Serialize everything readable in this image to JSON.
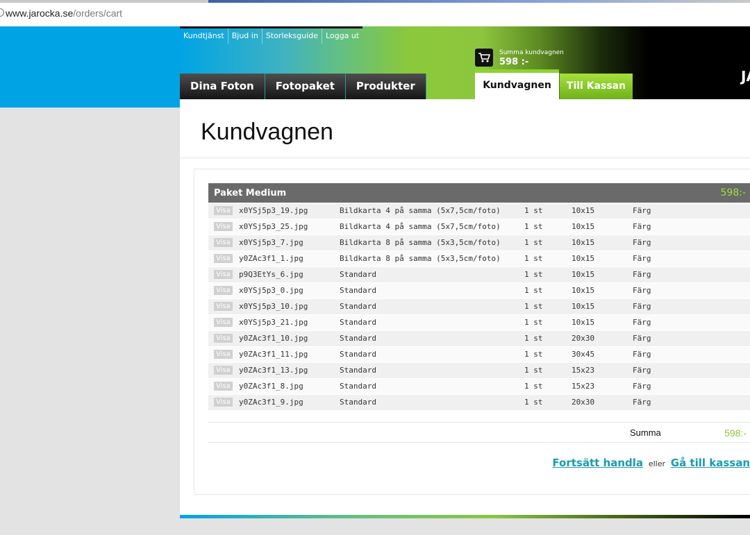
{
  "browser": {
    "url_domain": "www.jarocka.se",
    "url_path": "/orders/cart"
  },
  "topnav": [
    "Kundtjänst",
    "Bjud in",
    "Storleksguide",
    "Logga ut"
  ],
  "cart_summary": {
    "label": "Summa kundvagnen",
    "amount": "598 :-"
  },
  "tabs": [
    "Dina Foton",
    "Fotopaket",
    "Produkter"
  ],
  "active_tab": "Kundvagnen",
  "checkout_tab": "Till Kassan",
  "logo_text": "JA",
  "page_title": "Kundvagnen",
  "package": {
    "name": "Paket Medium",
    "price": "598:-"
  },
  "view_label": "Visa",
  "rows": [
    {
      "file": "x0YSj5p3_19.jpg",
      "product": "Bildkarta 4 på samma (5x7,5cm/foto)",
      "qty": "1 st",
      "size": "10x15",
      "color": "Färg"
    },
    {
      "file": "x0YSj5p3_25.jpg",
      "product": "Bildkarta 4 på samma (5x7,5cm/foto)",
      "qty": "1 st",
      "size": "10x15",
      "color": "Färg"
    },
    {
      "file": "x0YSj5p3_7.jpg",
      "product": "Bildkarta 8 på samma (5x3,5cm/foto)",
      "qty": "1 st",
      "size": "10x15",
      "color": "Färg"
    },
    {
      "file": "y0ZAc3f1_1.jpg",
      "product": "Bildkarta 8 på samma (5x3,5cm/foto)",
      "qty": "1 st",
      "size": "10x15",
      "color": "Färg"
    },
    {
      "file": "p9Q3EtYs_6.jpg",
      "product": "Standard",
      "qty": "1 st",
      "size": "10x15",
      "color": "Färg"
    },
    {
      "file": "x0YSj5p3_0.jpg",
      "product": "Standard",
      "qty": "1 st",
      "size": "10x15",
      "color": "Färg"
    },
    {
      "file": "x0YSj5p3_10.jpg",
      "product": "Standard",
      "qty": "1 st",
      "size": "10x15",
      "color": "Färg"
    },
    {
      "file": "x0YSj5p3_21.jpg",
      "product": "Standard",
      "qty": "1 st",
      "size": "10x15",
      "color": "Färg"
    },
    {
      "file": "y0ZAc3f1_10.jpg",
      "product": "Standard",
      "qty": "1 st",
      "size": "20x30",
      "color": "Färg"
    },
    {
      "file": "y0ZAc3f1_11.jpg",
      "product": "Standard",
      "qty": "1 st",
      "size": "30x45",
      "color": "Färg"
    },
    {
      "file": "y0ZAc3f1_13.jpg",
      "product": "Standard",
      "qty": "1 st",
      "size": "15x23",
      "color": "Färg"
    },
    {
      "file": "y0ZAc3f1_8.jpg",
      "product": "Standard",
      "qty": "1 st",
      "size": "15x23",
      "color": "Färg"
    },
    {
      "file": "y0ZAc3f1_9.jpg",
      "product": "Standard",
      "qty": "1 st",
      "size": "20x30",
      "color": "Färg"
    }
  ],
  "summary": {
    "label": "Summa",
    "value": "598:-"
  },
  "actions": {
    "continue": "Fortsätt handla",
    "or": "eller",
    "checkout": "Gå till kassan"
  },
  "colors": {
    "brand_blue": "#00a4e4",
    "brand_green": "#8cc63e",
    "link": "#1a9ab0"
  },
  "icons": [
    "globe-icon",
    "cart-icon"
  ]
}
